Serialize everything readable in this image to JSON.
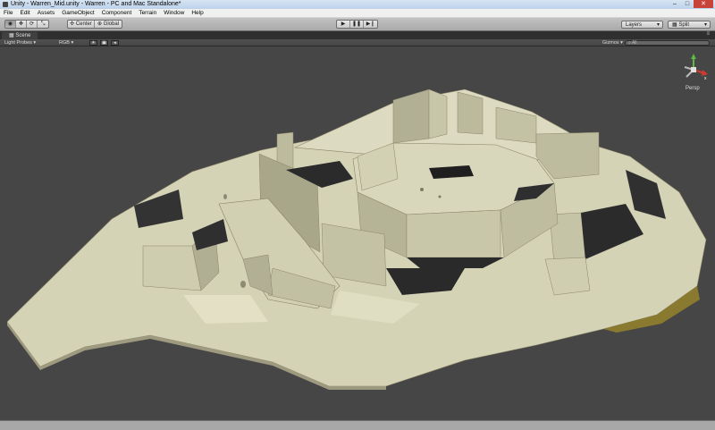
{
  "window": {
    "title": "Unity - Warren_Mid.unity - Warren - PC and Mac Standalone*",
    "minimize_icon": "minimize-icon",
    "maximize_icon": "maximize-icon",
    "close_icon": "close-icon"
  },
  "menu": {
    "items": [
      "File",
      "Edit",
      "Assets",
      "GameObject",
      "Component",
      "Terrain",
      "Window",
      "Help"
    ]
  },
  "toolbar": {
    "tools": [
      "eye-icon",
      "move-icon",
      "rotate-icon",
      "scale-icon"
    ],
    "pivot_mode": "Center",
    "pivot_rotation": "Global",
    "play_controls": [
      "play-icon",
      "pause-icon",
      "step-icon"
    ],
    "layers_label": "Layers",
    "layout_label": "Split"
  },
  "scene": {
    "tab_label": "Scene",
    "render_mode": "Light Probes",
    "color_mode": "RGB",
    "gizmos_label": "Gizmos",
    "search_placeholder": "All",
    "projection_label": "Persp",
    "colors": {
      "background": "#464646",
      "floor": "#d5d3b6",
      "wall": "#bfbd9f",
      "shadow": "#262626",
      "edge": "#8a8468"
    }
  }
}
